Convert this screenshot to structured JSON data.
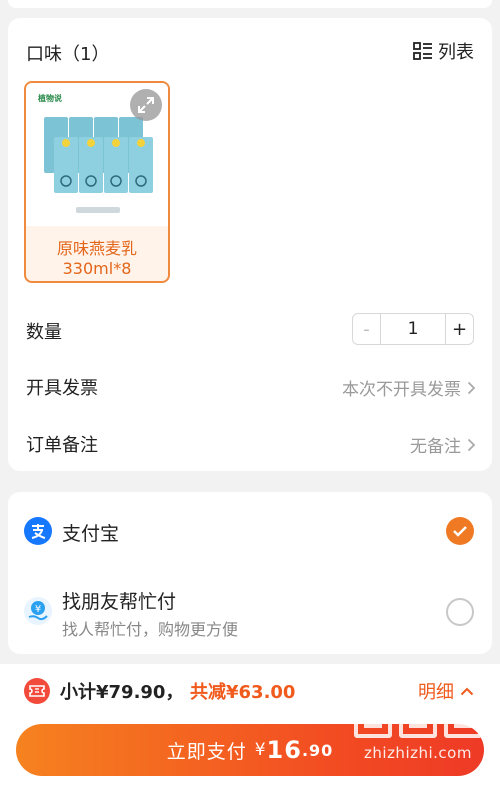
{
  "order": {
    "flavor_header": "口味（1）",
    "list_toggle_label": "列表",
    "product": {
      "name": "原味燕麦乳",
      "spec": "330ml*8",
      "image_icon": "oat-milk-carton-pack",
      "brand_text": "植物说"
    },
    "quantity": {
      "label": "数量",
      "value": "1",
      "minus": "-",
      "plus": "+"
    },
    "invoice": {
      "label": "开具发票",
      "value": "本次不开具发票"
    },
    "remark": {
      "label": "订单备注",
      "value": "无备注"
    }
  },
  "payment_methods": [
    {
      "name": "支付宝",
      "icon": "alipay-icon",
      "selected": true
    },
    {
      "name": "找朋友帮忙付",
      "subtitle": "找人帮忙付，购物更方便",
      "icon": "friend-pay-icon",
      "selected": false
    }
  ],
  "summary": {
    "subtotal": "小计¥79.90，",
    "discount": "共减¥63.00",
    "detail_label": "明细"
  },
  "pay_button": {
    "label": "立即支付",
    "currency": "¥",
    "amount_int": "16",
    "amount_dec": ".90"
  },
  "watermark": {
    "text": "zhizhizhi.com"
  },
  "colors": {
    "accent": "#f07a24",
    "accent_red": "#f05a1c",
    "alipay_blue": "#1677ff",
    "background": "#f2f2f2"
  }
}
